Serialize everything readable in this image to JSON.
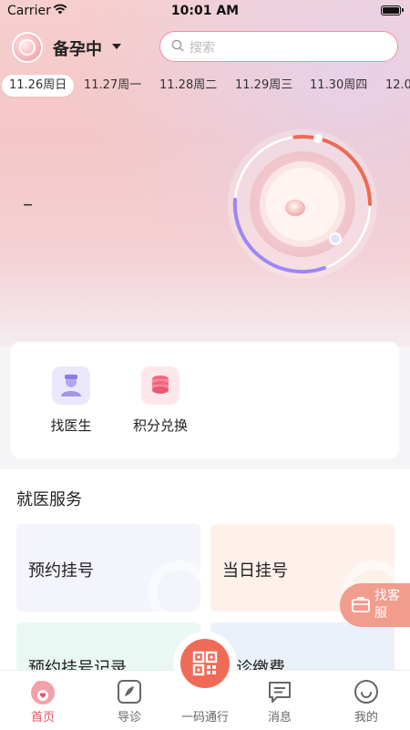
{
  "status_bar": {
    "carrier": "Carrier",
    "time": "10:01 AM"
  },
  "header": {
    "status_label": "备孕中",
    "search_placeholder": "搜索"
  },
  "dates": [
    {
      "label": "11.26周日",
      "active": true
    },
    {
      "label": "11.27周一",
      "active": false
    },
    {
      "label": "11.28周二",
      "active": false
    },
    {
      "label": "11.29周三",
      "active": false
    },
    {
      "label": "11.30周四",
      "active": false
    },
    {
      "label": "12.0",
      "active": false
    }
  ],
  "hero": {
    "placeholder_value": "–"
  },
  "quick": [
    {
      "label": "找医生",
      "icon": "doctor-icon"
    },
    {
      "label": "积分兑换",
      "icon": "coins-icon"
    }
  ],
  "services": {
    "title": "就医服务",
    "items": [
      {
        "label": "预约挂号",
        "color": "#f3f4fc"
      },
      {
        "label": "当日挂号",
        "color": "#fdf1ea"
      },
      {
        "label": "预约挂号记录",
        "color": "#eaf8f4"
      },
      {
        "label": "诊缴费",
        "color": "#eaf1fb"
      }
    ]
  },
  "kefu": {
    "label": "找客服"
  },
  "tabs": [
    {
      "label": "首页",
      "icon": "home-icon",
      "active": true
    },
    {
      "label": "导诊",
      "icon": "compass-icon",
      "active": false
    },
    {
      "label": "一码通行",
      "icon": "qrcode-icon",
      "active": false
    },
    {
      "label": "消息",
      "icon": "message-icon",
      "active": false
    },
    {
      "label": "我的",
      "icon": "profile-icon",
      "active": false
    }
  ],
  "colors": {
    "accent": "#e8525f",
    "ring_orange": "#ef6a4e",
    "ring_purple": "#9b87f5",
    "qr_button": "#f06b57"
  }
}
